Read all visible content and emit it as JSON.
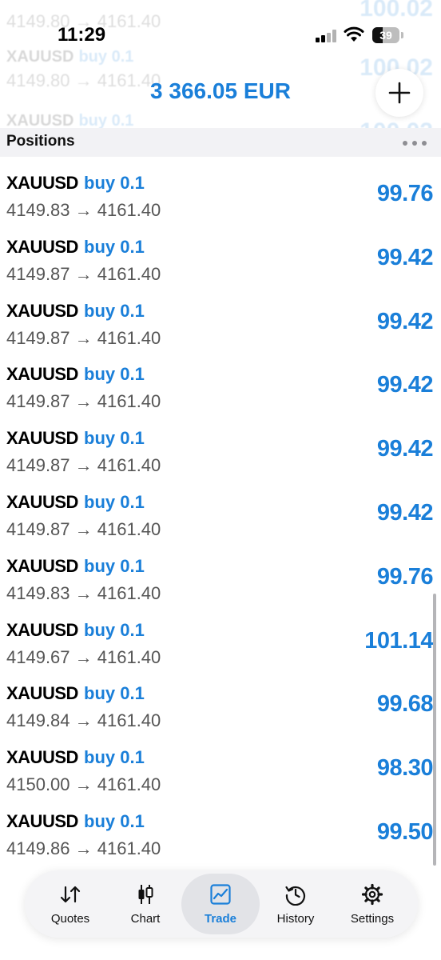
{
  "status_bar": {
    "time": "11:29",
    "battery": "39"
  },
  "ghost_rows": [
    {
      "symbol": "XAUUSD",
      "side": "buy 0.1",
      "prices": "4149.80 → 4161.40",
      "profit": "100.02"
    },
    {
      "symbol": "XAUUSD",
      "side": "buy 0.1",
      "prices": "4149.80 → 4161.40",
      "profit": "100.02"
    },
    {
      "symbol": "XAUUSD",
      "side": "buy 0.1",
      "prices": "",
      "profit": "100.02"
    }
  ],
  "header": {
    "balance": "3 366.05 EUR",
    "add_label": "+"
  },
  "section": {
    "title": "Positions"
  },
  "positions": [
    {
      "symbol": "XAUUSD",
      "side": "buy 0.1",
      "prices": "4149.83 → 4161.40",
      "profit": "99.76"
    },
    {
      "symbol": "XAUUSD",
      "side": "buy 0.1",
      "prices": "4149.87 → 4161.40",
      "profit": "99.42"
    },
    {
      "symbol": "XAUUSD",
      "side": "buy 0.1",
      "prices": "4149.87 → 4161.40",
      "profit": "99.42"
    },
    {
      "symbol": "XAUUSD",
      "side": "buy 0.1",
      "prices": "4149.87 → 4161.40",
      "profit": "99.42"
    },
    {
      "symbol": "XAUUSD",
      "side": "buy 0.1",
      "prices": "4149.87 → 4161.40",
      "profit": "99.42"
    },
    {
      "symbol": "XAUUSD",
      "side": "buy 0.1",
      "prices": "4149.87 → 4161.40",
      "profit": "99.42"
    },
    {
      "symbol": "XAUUSD",
      "side": "buy 0.1",
      "prices": "4149.83 → 4161.40",
      "profit": "99.76"
    },
    {
      "symbol": "XAUUSD",
      "side": "buy 0.1",
      "prices": "4149.67 → 4161.40",
      "profit": "101.14"
    },
    {
      "symbol": "XAUUSD",
      "side": "buy 0.1",
      "prices": "4149.84 → 4161.40",
      "profit": "99.68"
    },
    {
      "symbol": "XAUUSD",
      "side": "buy 0.1",
      "prices": "4150.00 → 4161.40",
      "profit": "98.30"
    },
    {
      "symbol": "XAUUSD",
      "side": "buy 0.1",
      "prices": "4149.86 → 4161.40",
      "profit": "99.50"
    }
  ],
  "tabs": [
    {
      "label": "Quotes",
      "icon": "quotes-icon",
      "active": false
    },
    {
      "label": "Chart",
      "icon": "chart-icon",
      "active": false
    },
    {
      "label": "Trade",
      "icon": "trade-icon",
      "active": true
    },
    {
      "label": "History",
      "icon": "history-icon",
      "active": false
    },
    {
      "label": "Settings",
      "icon": "settings-icon",
      "active": false
    }
  ],
  "colors": {
    "accent": "#1a7fd9",
    "section_bg": "#f2f2f5",
    "tabbar_bg": "#f4f4f6"
  }
}
